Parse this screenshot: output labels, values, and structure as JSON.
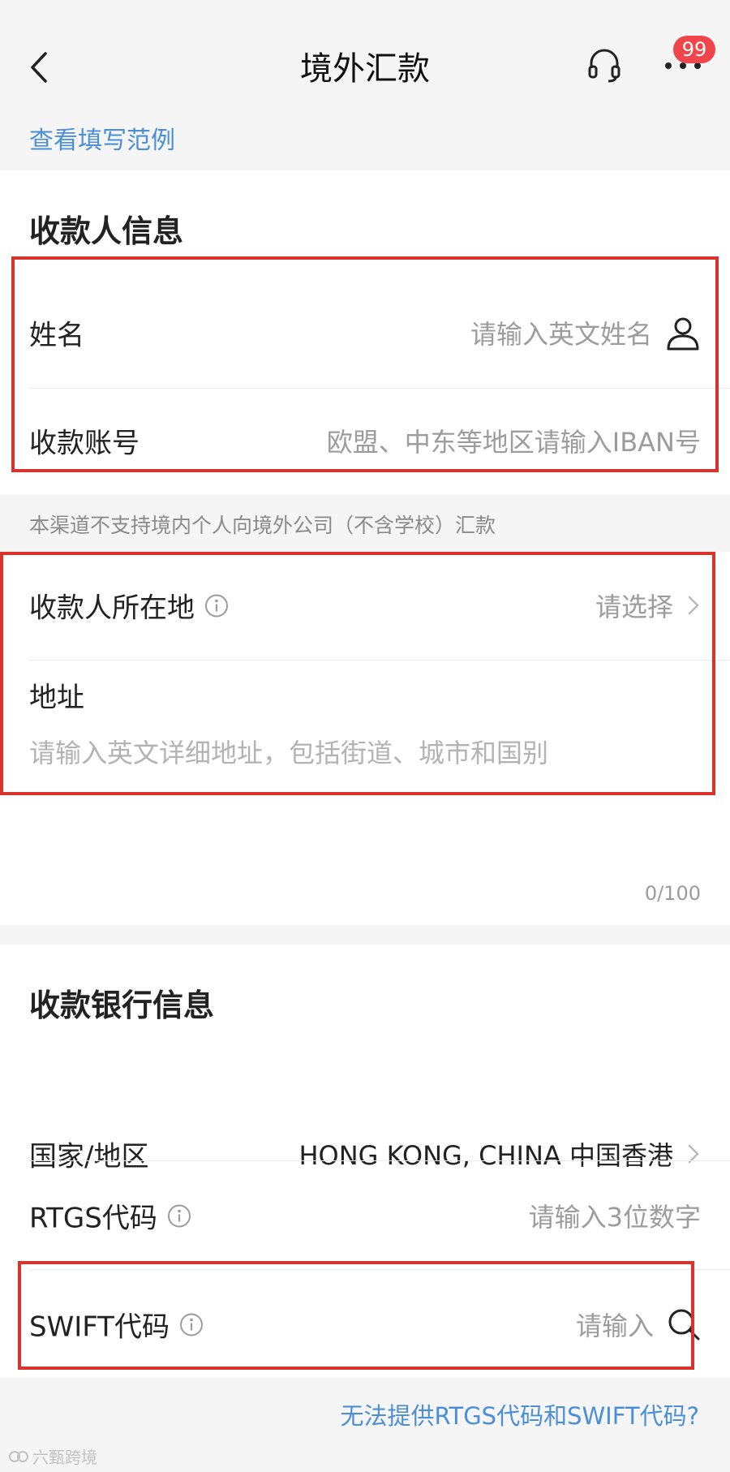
{
  "nav": {
    "title": "境外汇款",
    "badge": "99",
    "back_icon": "chevron-left-icon",
    "headset_icon": "headset-icon",
    "more_icon": "more-dots-icon"
  },
  "example_link": "查看填写范例",
  "payee": {
    "title": "收款人信息",
    "name_label": "姓名",
    "name_placeholder": "请输入英文姓名",
    "account_label": "收款账号",
    "account_placeholder": "欧盟、中东等地区请输入IBAN号"
  },
  "notice": "本渠道不支持境内个人向境外公司（不含学校）汇款",
  "location": {
    "label": "收款人所在地",
    "value": "请选择",
    "address_label": "地址",
    "address_placeholder": "请输入英文详细地址，包括街道、城市和国别",
    "counter": "0/100"
  },
  "bank": {
    "title": "收款银行信息",
    "country_label": "国家/地区",
    "country_value": "HONG KONG, CHINA 中国香港",
    "rtgs_label": "RTGS代码",
    "rtgs_placeholder": "请输入3位数字",
    "swift_label": "SWIFT代码",
    "swift_placeholder": "请输入"
  },
  "bottom_link": "无法提供RTGS代码和SWIFT代码?",
  "watermark": "六甄跨境",
  "colors": {
    "accent": "#4a8fd8",
    "badge": "#f0464b",
    "highlight": "#d6342c",
    "background": "#f5f5f5"
  }
}
